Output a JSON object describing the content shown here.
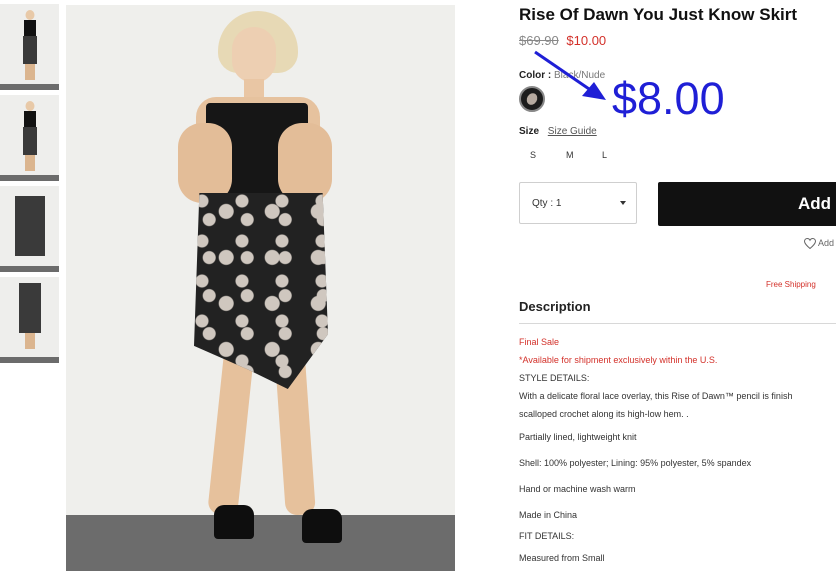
{
  "product": {
    "title": "Rise Of Dawn You Just Know Skirt",
    "old_price": "$69.90",
    "new_price": "$10.00",
    "color_label": "Color :",
    "color_value": "Black/Nude",
    "size_label": "Size",
    "size_guide": "Size Guide",
    "sizes": [
      "S",
      "M",
      "L"
    ],
    "qty_label": "Qty : 1",
    "add_button": "Add",
    "wishlist": "Add",
    "shipping_note": "Free Shipping"
  },
  "annotation": {
    "price_overlay": "$8.00",
    "color": "#1f1fd6"
  },
  "description": {
    "title": "Description",
    "final_sale": "Final Sale",
    "availability": "*Available for shipment exclusively within the U.S.",
    "style_details_label": "STYLE DETAILS:",
    "style_text_1": "With a delicate floral lace overlay, this Rise of Dawn™ pencil is finish",
    "style_text_2": "scalloped crochet along its high-low hem. .",
    "lining": "Partially lined, lightweight knit",
    "content": "Shell: 100% polyester; Lining: 95% polyester, 5% spandex",
    "care": "Hand or machine wash warm",
    "origin": "Made in China",
    "fit_details_label": "FIT DETAILS:",
    "fit_text": "Measured from Small"
  },
  "colors": {
    "sale_red": "#d3312a",
    "button_black": "#111111"
  }
}
